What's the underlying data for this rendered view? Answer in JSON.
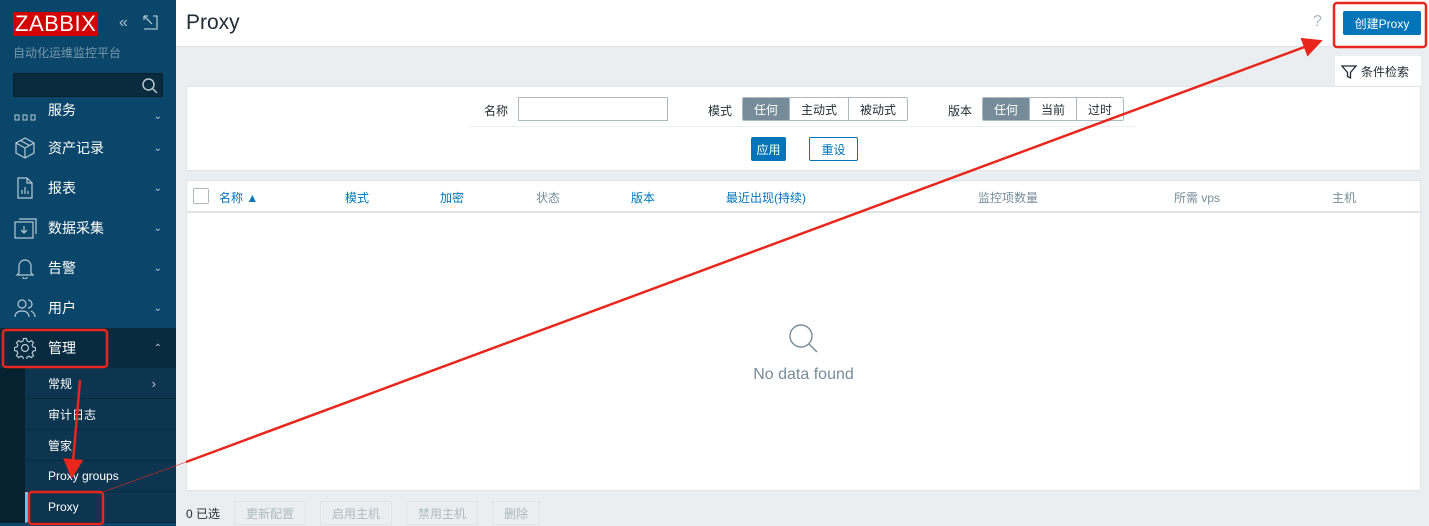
{
  "sidebar": {
    "logo": "ZABBIX",
    "subtitle": "自动化运维监控平台",
    "search": {
      "placeholder": "",
      "value": ""
    },
    "items": [
      {
        "label": "服务",
        "icon": "services-icon"
      },
      {
        "label": "资产记录",
        "icon": "box-icon"
      },
      {
        "label": "报表",
        "icon": "report-icon"
      },
      {
        "label": "数据采集",
        "icon": "data-collection-icon"
      },
      {
        "label": "告警",
        "icon": "bell-icon"
      },
      {
        "label": "用户",
        "icon": "users-icon"
      },
      {
        "label": "管理",
        "icon": "gear-icon"
      }
    ],
    "submenu": [
      {
        "label": "常规"
      },
      {
        "label": "审计日志"
      },
      {
        "label": "管家"
      },
      {
        "label": "Proxy groups"
      },
      {
        "label": "Proxy"
      }
    ]
  },
  "header": {
    "title": "Proxy",
    "help": "?",
    "create_button": "创建Proxy"
  },
  "filter": {
    "tab_label": "条件检索",
    "name_label": "名称",
    "name_value": "",
    "mode_label": "模式",
    "mode_options": [
      "任何",
      "主动式",
      "被动式"
    ],
    "mode_selected": "任何",
    "version_label": "版本",
    "version_options": [
      "任何",
      "当前",
      "过时"
    ],
    "version_selected": "任何",
    "apply": "应用",
    "reset": "重设"
  },
  "table": {
    "columns": [
      "名称 ▲",
      "模式",
      "加密",
      "状态",
      "版本",
      "最近出现(持续)",
      "监控项数量",
      "所需 vps",
      "主机"
    ],
    "rows": [],
    "empty_text": "No data found"
  },
  "footer": {
    "selected": "0 已选",
    "buttons": [
      "更新配置",
      "启用主机",
      "禁用主机",
      "删除"
    ]
  },
  "colors": {
    "sidebar": "#0a466a",
    "primary": "#0275b8",
    "logo": "#d40000",
    "annotation": "#e8261c"
  }
}
